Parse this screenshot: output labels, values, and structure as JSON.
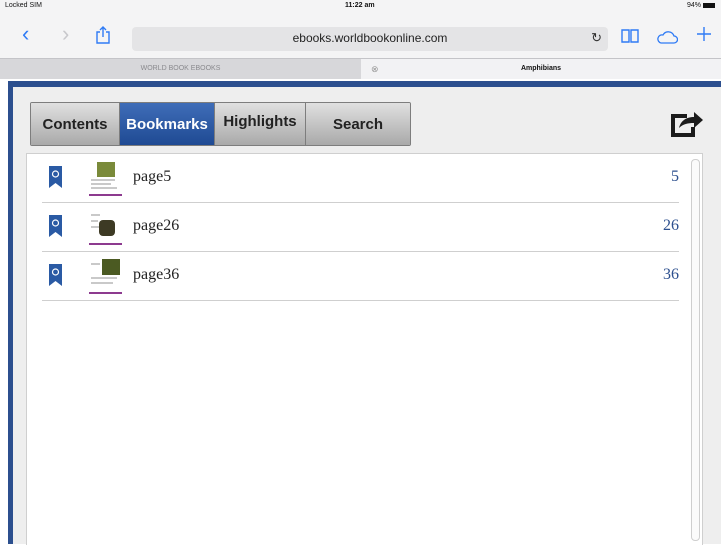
{
  "status_bar": {
    "carrier": "Locked SIM",
    "time": "11:22 am",
    "battery": "94%"
  },
  "browser": {
    "url": "ebooks.worldbookonline.com",
    "tabs": [
      {
        "label": "WORLD BOOK EBOOKS",
        "active": false
      },
      {
        "label": "Amphibians",
        "active": true
      }
    ]
  },
  "reader": {
    "tabs": [
      {
        "label": "Contents",
        "active": false
      },
      {
        "label": "Bookmarks",
        "active": true
      },
      {
        "label": "Highlights",
        "active": false
      },
      {
        "label": "Search",
        "active": false
      }
    ],
    "bookmarks": [
      {
        "label": "page5",
        "page": "5"
      },
      {
        "label": "page26",
        "page": "26"
      },
      {
        "label": "page36",
        "page": "36"
      }
    ]
  },
  "colors": {
    "accent": "#2c4f8e",
    "ios_blue": "#2f7bf5",
    "active_tab": "#2a5aa4",
    "thumb_underline": "#8d3a8f"
  }
}
